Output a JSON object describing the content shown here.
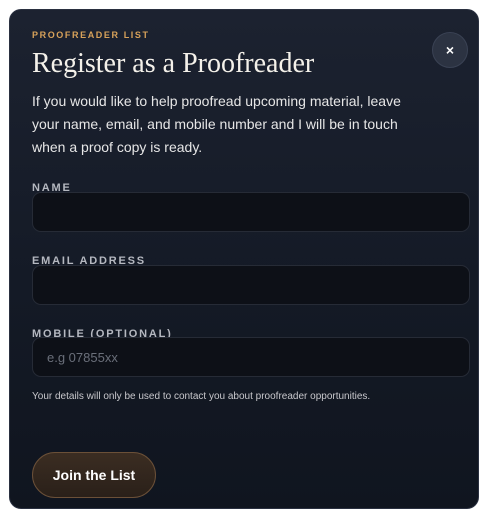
{
  "modal": {
    "eyebrow": "PROOFREADER LIST",
    "title": "Register as a Proofreader",
    "close_label": "×",
    "intro": "If you would like to help proofread upcoming material, leave your name, email, and mobile number and I will be in touch when a proof copy is ready."
  },
  "form": {
    "name_label": "NAME",
    "name_value": "",
    "email_label": "EMAIL ADDRESS",
    "email_value": "",
    "mobile_label": "MOBILE (OPTIONAL)",
    "mobile_placeholder": "e.g 07855xx",
    "mobile_value": "",
    "privacy_note": "Your details will only be used to contact you about proofreader opportunities.",
    "submit_label": "Join the List"
  }
}
